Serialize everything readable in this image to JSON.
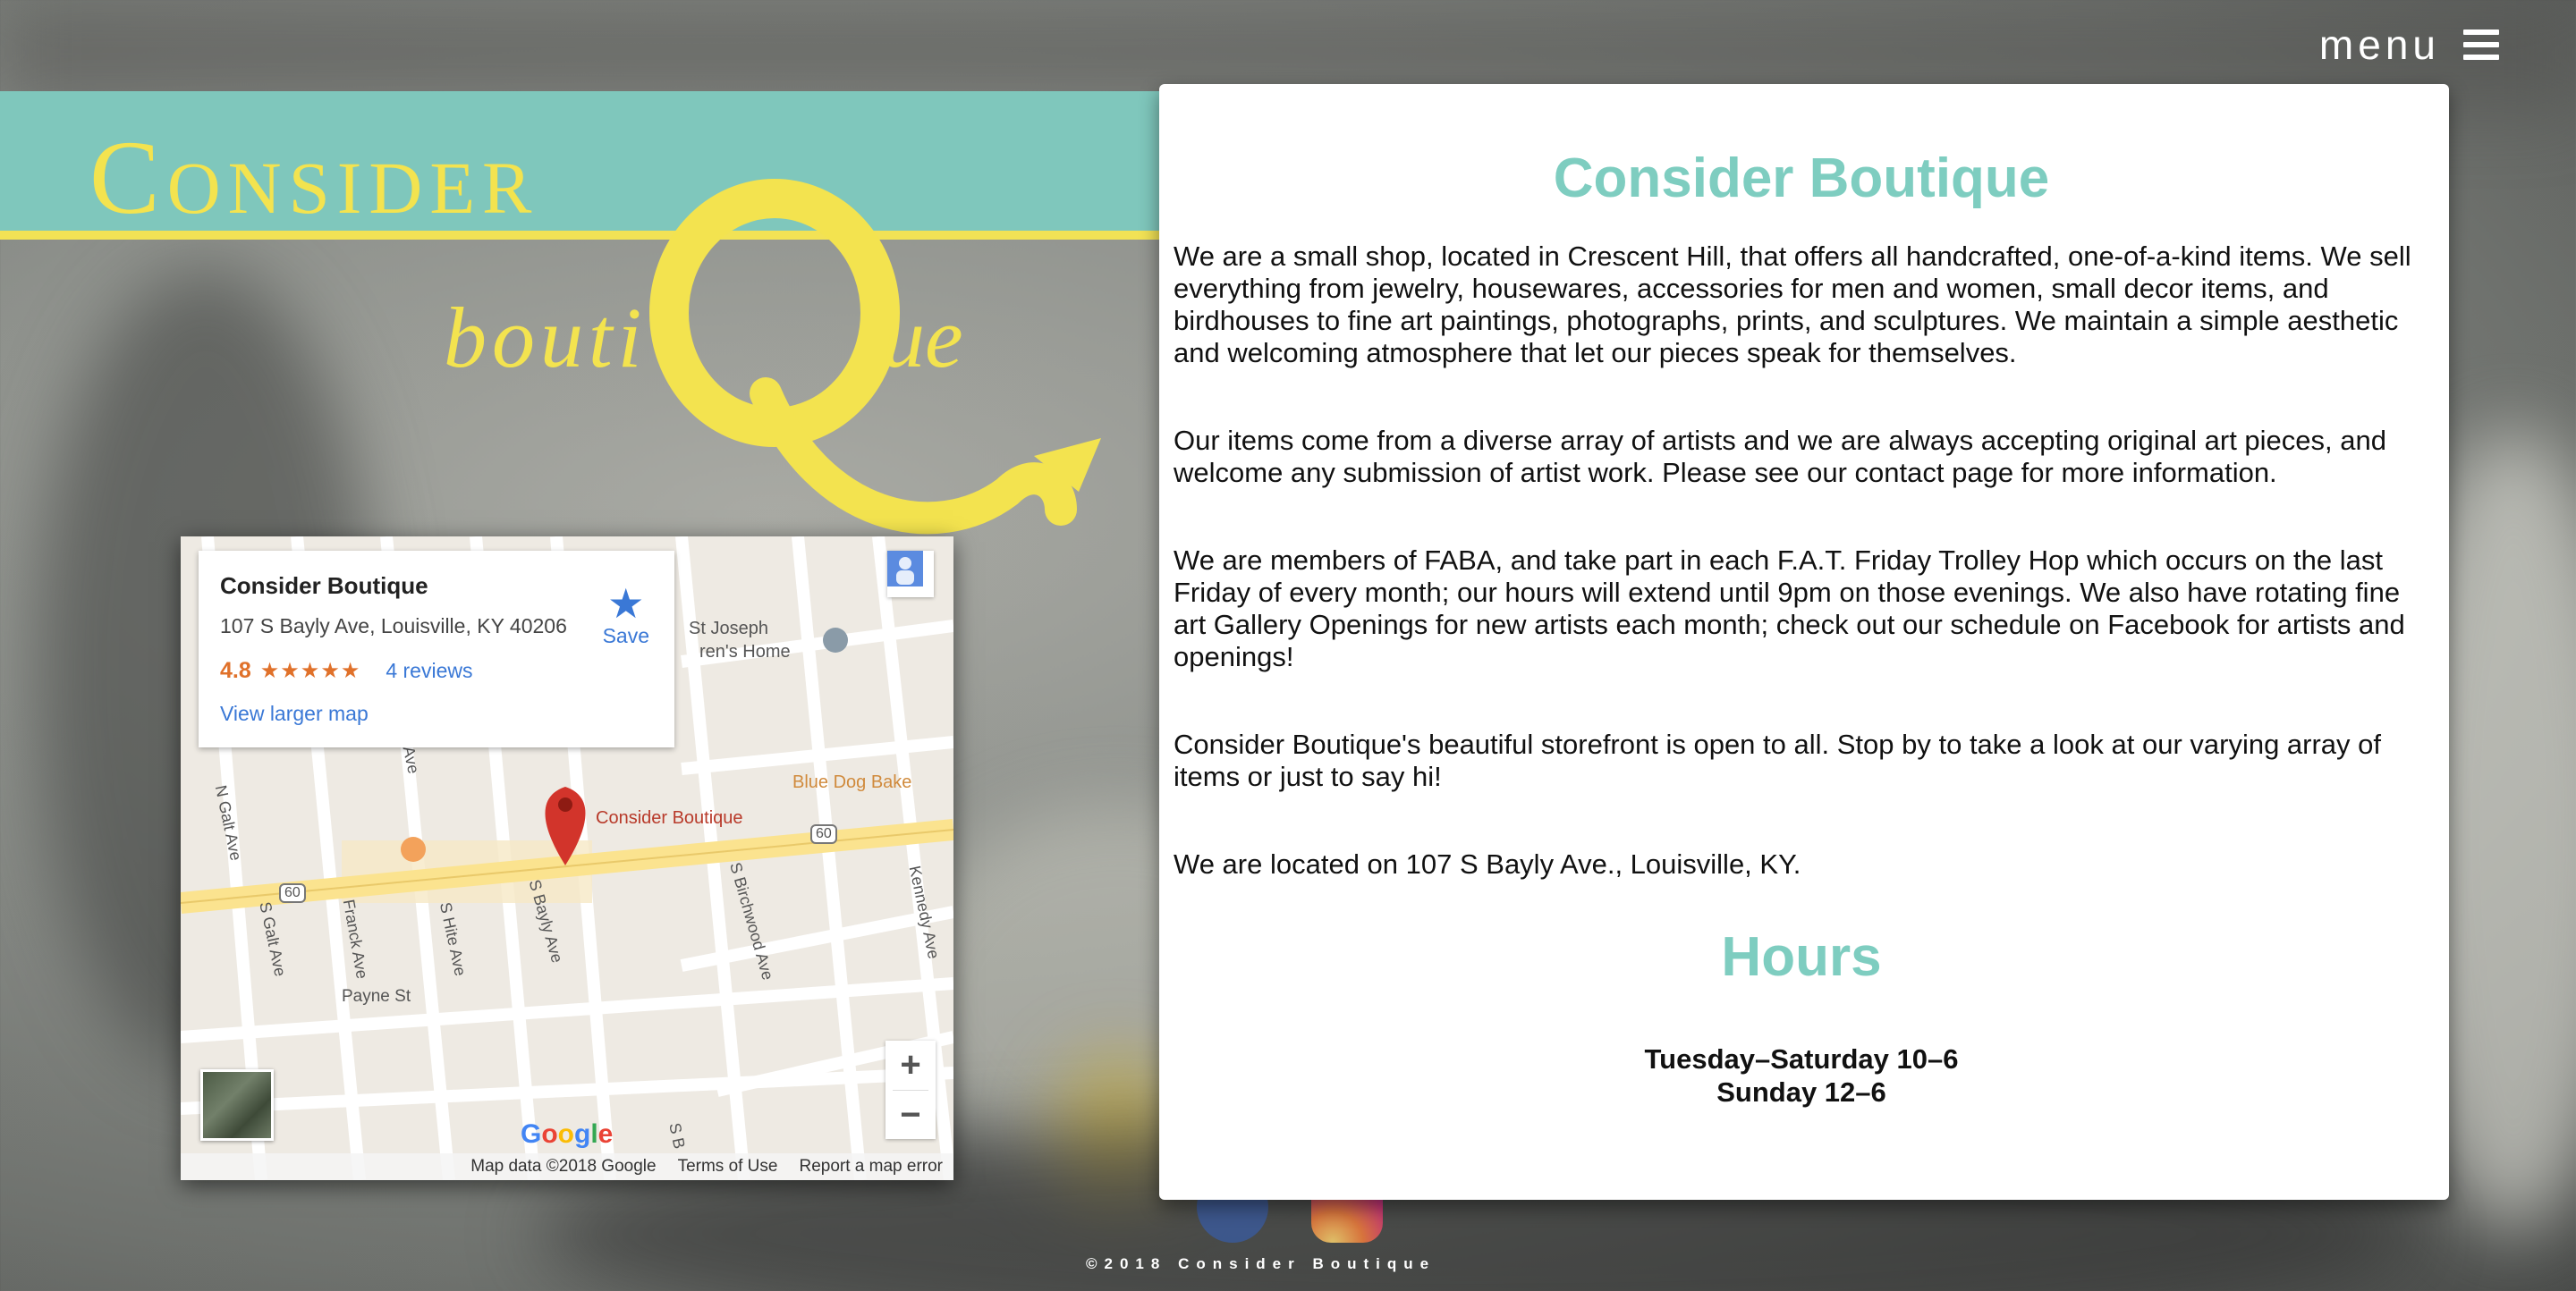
{
  "header": {
    "menu_label": "menu"
  },
  "logo": {
    "line1": "Consider",
    "line2_a": "bouti",
    "line2_b": "ue",
    "colors": {
      "teal": "#7fc7bc",
      "yellow": "#f3e34f"
    }
  },
  "map": {
    "place_name": "Consider Boutique",
    "address": "107 S Bayly Ave, Louisville, KY 40206",
    "rating": "4.8",
    "stars": "★★★★★",
    "reviews_link": "4 reviews",
    "larger_map_link": "View larger map",
    "save_label": "Save",
    "pin_label": "Consider Boutique",
    "labels": {
      "st_joseph": "St Joseph",
      "childrens_home": "ren's Home",
      "blue_dog": "Blue Dog Bake",
      "hite_ave_top": "Hite Ave",
      "n_galt_ave": "N Galt Ave",
      "s_galt_ave": "S Galt Ave",
      "franck_ave": "Franck Ave",
      "s_hite_ave": "S Hite Ave",
      "s_bayly_ave": "S Bayly Ave",
      "s_birchwood_ave": "S Birchwood Ave",
      "kennedy_ave": "Kennedy Ave",
      "payne_st": "Payne St",
      "route_60_a": "60",
      "route_60_b": "60",
      "s_b": "S B"
    },
    "google_logo": "Google",
    "footer": {
      "data": "Map data ©2018 Google",
      "terms": "Terms of Use",
      "report": "Report a map error"
    },
    "zoom_in": "+",
    "zoom_out": "−"
  },
  "content": {
    "title": "Consider Boutique",
    "paragraphs": [
      "We are a small shop, located in Crescent Hill, that offers all handcrafted, one-of-a-kind items. We sell everything from jewelry, housewares, accessories for men and women, small decor items, and birdhouses to fine art paintings, photographs, prints, and sculptures. We maintain a simple aesthetic and welcoming atmosphere that let our pieces speak for themselves.",
      "Our items come from a diverse array of artists and we are always accepting original art pieces, and welcome any submission of artist work. Please see our contact page for more information.",
      "We are members of FABA, and take part in each F.A.T. Friday Trolley Hop which occurs on the last Friday of every month; our hours will extend until 9pm on those evenings. We also have rotating fine art Gallery Openings for new artists each month; check out our schedule on Facebook for artists and openings!",
      "Consider Boutique's beautiful storefront is open to all. Stop by to take a look at our varying array of items or just to say hi!",
      "We are located on 107 S Bayly Ave., Louisville, KY."
    ],
    "hours_title": "Hours",
    "hours": [
      "Tuesday–Saturday 10–6",
      "Sunday 12–6"
    ]
  },
  "social": {
    "icons": [
      "facebook-icon",
      "instagram-icon"
    ]
  },
  "footer": {
    "copyright": "©2018 Consider Boutique"
  }
}
